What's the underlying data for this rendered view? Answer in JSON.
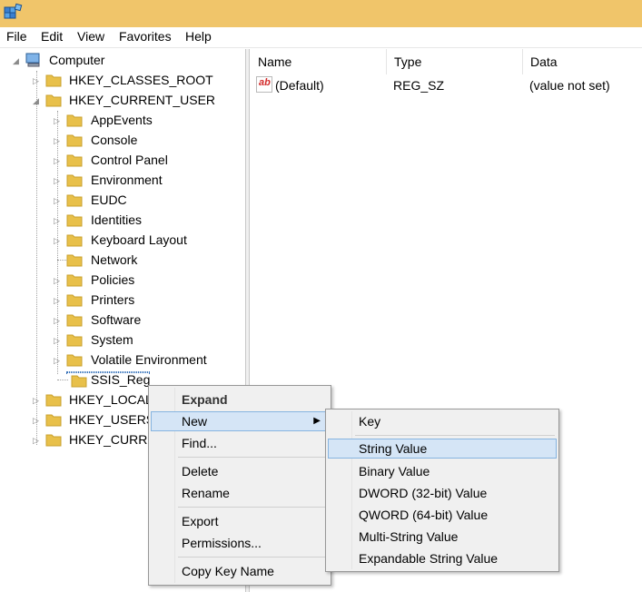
{
  "menubar": {
    "file": "File",
    "edit": "Edit",
    "view": "View",
    "favorites": "Favorites",
    "help": "Help"
  },
  "tree": {
    "root": "Computer",
    "hkcr": "HKEY_CLASSES_ROOT",
    "hkcu": "HKEY_CURRENT_USER",
    "children": [
      "AppEvents",
      "Console",
      "Control Panel",
      "Environment",
      "EUDC",
      "Identities",
      "Keyboard Layout",
      "Network",
      "Policies",
      "Printers",
      "Software",
      "System",
      "Volatile Environment"
    ],
    "selected": "SSIS_Reg",
    "hklm": "HKEY_LOCAL",
    "hku": "HKEY_USERS",
    "hkcc": "HKEY_CURRE"
  },
  "list": {
    "headers": {
      "name": "Name",
      "type": "Type",
      "data": "Data"
    },
    "rows": [
      {
        "name": "(Default)",
        "type": "REG_SZ",
        "data": "(value not set)"
      }
    ]
  },
  "context_menu": {
    "expand": "Expand",
    "new": "New",
    "find": "Find...",
    "delete": "Delete",
    "rename": "Rename",
    "export": "Export",
    "permissions": "Permissions...",
    "copy_key_name": "Copy Key Name"
  },
  "submenu": {
    "key": "Key",
    "string_value": "String Value",
    "binary_value": "Binary Value",
    "dword": "DWORD (32-bit) Value",
    "qword": "QWORD (64-bit) Value",
    "multi_string": "Multi-String Value",
    "expandable_string": "Expandable String Value"
  },
  "colors": {
    "titlebar": "#f0c56a",
    "highlight": "#d5e5f6",
    "folder": "#e8c04a"
  }
}
